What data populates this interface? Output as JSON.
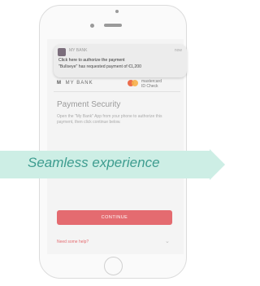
{
  "notification": {
    "app_name": "MY BANK",
    "time": "now",
    "title": "Click here to authorize the payment",
    "body": "\"Bullseye\" has requested payment of €1,200"
  },
  "bank": {
    "logo_mark": "M",
    "name": "MY BANK"
  },
  "mastercard": {
    "line1": "mastercard",
    "line2": "ID Check"
  },
  "page": {
    "title": "Payment Security",
    "description": "Open the \"My Bank\" App from your phone to authorize this payment, then click continue below."
  },
  "banner": {
    "text": "Seamless experience",
    "color": "#3d9c8f",
    "fill": "#cdeee5"
  },
  "continue_button": {
    "label": "CONTINUE",
    "color": "#e46b70"
  },
  "help_link": {
    "label": "Need some help?"
  },
  "icons": {
    "help": "chevron-down-icon"
  }
}
